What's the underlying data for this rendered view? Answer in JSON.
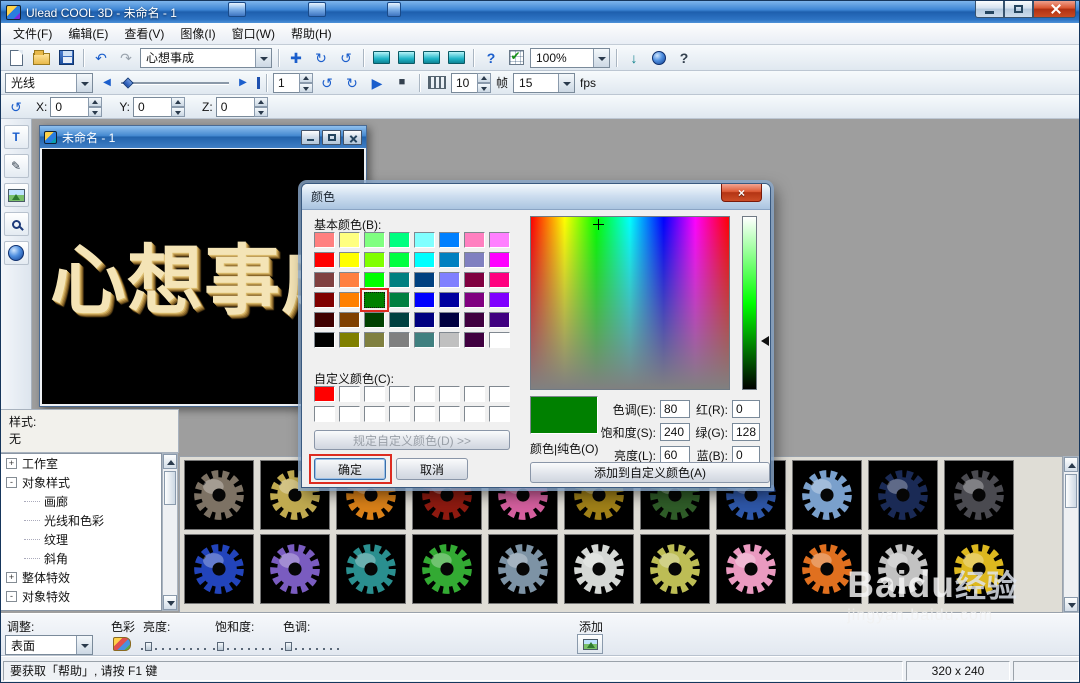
{
  "titlebar": {
    "title": "Ulead COOL 3D - 未命名 - 1"
  },
  "menubar": {
    "items": [
      "文件(F)",
      "编辑(E)",
      "查看(V)",
      "图像(I)",
      "窗口(W)",
      "帮助(H)"
    ]
  },
  "toolbar": {
    "preset_value": "心想事成",
    "zoom_value": "100%"
  },
  "animbar": {
    "light_value": "光线",
    "frame_value": "1",
    "duration_value": "10",
    "duration_unit": "帧",
    "fps_value": "15",
    "fps_unit": "fps"
  },
  "positionbar": {
    "x_label": "X:",
    "x_value": "0",
    "y_label": "Y:",
    "y_value": "0",
    "z_label": "Z:",
    "z_value": "0"
  },
  "document": {
    "title": "未命名 - 1",
    "canvas_text": "心想事成"
  },
  "style_panel": {
    "label": "样式:",
    "value": "无"
  },
  "tree": {
    "items": [
      {
        "label": "工作室",
        "toggle": "+",
        "level": 0
      },
      {
        "label": "对象样式",
        "toggle": "-",
        "level": 0
      },
      {
        "label": "画廊",
        "toggle": "",
        "level": 1
      },
      {
        "label": "光线和色彩",
        "toggle": "",
        "level": 1
      },
      {
        "label": "纹理",
        "toggle": "",
        "level": 1
      },
      {
        "label": "斜角",
        "toggle": "",
        "level": 1
      },
      {
        "label": "整体特效",
        "toggle": "+",
        "level": 0
      },
      {
        "label": "对象特效",
        "toggle": "-",
        "level": 0
      }
    ]
  },
  "color_dialog": {
    "title": "颜色",
    "basic_colors_label": "基本颜色(B):",
    "basic_colors": [
      "#FF8080",
      "#FFFF80",
      "#80FF80",
      "#00FF80",
      "#80FFFF",
      "#0080FF",
      "#FF80C0",
      "#FF80FF",
      "#FF0000",
      "#FFFF00",
      "#80FF00",
      "#00FF40",
      "#00FFFF",
      "#0080C0",
      "#8080C0",
      "#FF00FF",
      "#804040",
      "#FF8040",
      "#00FF00",
      "#008080",
      "#004080",
      "#8080FF",
      "#800040",
      "#FF0080",
      "#800000",
      "#FF8000",
      "#008000",
      "#008040",
      "#0000FF",
      "#0000A0",
      "#800080",
      "#8000FF",
      "#400000",
      "#804000",
      "#004000",
      "#004040",
      "#000080",
      "#000040",
      "#400040",
      "#400080",
      "#000000",
      "#808000",
      "#808040",
      "#808080",
      "#408080",
      "#C0C0C0",
      "#400040",
      "#FFFFFF"
    ],
    "selected_index": 26,
    "custom_colors_label": "自定义颜色(C):",
    "custom_colors": [
      "#FF0000",
      "#FFFFFF",
      "#FFFFFF",
      "#FFFFFF",
      "#FFFFFF",
      "#FFFFFF",
      "#FFFFFF",
      "#FFFFFF",
      "#FFFFFF",
      "#FFFFFF",
      "#FFFFFF",
      "#FFFFFF",
      "#FFFFFF",
      "#FFFFFF",
      "#FFFFFF",
      "#FFFFFF"
    ],
    "define_custom_label": "规定自定义颜色(D) >>",
    "ok_label": "确定",
    "cancel_label": "取消",
    "preview_color": "#008000",
    "color_solid_label": "颜色|纯色(O)",
    "hue_label": "色调(E):",
    "hue_value": "80",
    "sat_label": "饱和度(S):",
    "sat_value": "240",
    "lum_label": "亮度(L):",
    "lum_value": "60",
    "red_label": "红(R):",
    "red_value": "0",
    "green_label": "绿(G):",
    "green_value": "128",
    "blue_label": "蓝(B):",
    "blue_value": "0",
    "add_custom_label": "添加到自定义颜色(A)"
  },
  "gallery": {
    "row1": [
      "#7d7264",
      "#c0aa50",
      "#d98018",
      "#8e1a10",
      "#d45f9e",
      "#a08018",
      "#2f5c28",
      "#2e57a8",
      "#7aa0cc",
      "#1a2a55",
      "#4a4a50"
    ],
    "row2": [
      "#2244bb",
      "#7a5cc0",
      "#2a8f8f",
      "#33aa33",
      "#7d93a5",
      "#d5d8d5",
      "#bdbd55",
      "#ea9ac0",
      "#e0701f",
      "#c2c2c2",
      "#ddb81f"
    ]
  },
  "adjustbar": {
    "adjust_label": "调整:",
    "adjust_value": "表面",
    "color_label": "色彩",
    "brightness_label": "亮度:",
    "saturation_label": "饱和度:",
    "hue_label": "色调:",
    "add_label": "添加"
  },
  "statusbar": {
    "help_text": "要获取「帮助」, 请按 F1 键",
    "size_text": "320 x 240"
  },
  "watermark": {
    "brand": "Baidu",
    "brand_suffix": "经验",
    "url": "jingyan.baidu.com"
  },
  "icons": {
    "undo": "↶",
    "redo": "↷",
    "rotate": "↻",
    "orbit": "↺",
    "move": "✚",
    "help": "?",
    "play": "▶",
    "stop": "■",
    "step_back": "◀",
    "step_fwd": "▶",
    "text_tool": "T",
    "edit_pencil": "✎",
    "close": "×",
    "export": "↓"
  }
}
